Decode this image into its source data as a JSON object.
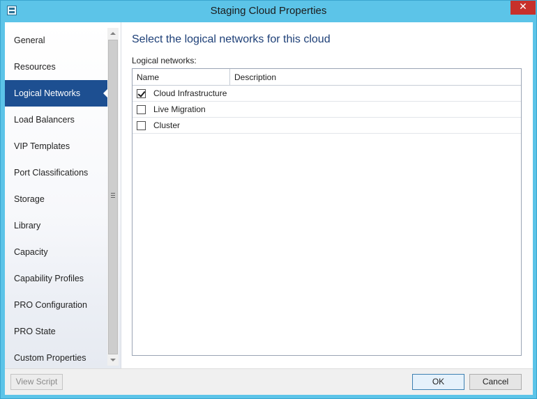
{
  "window": {
    "title": "Staging Cloud Properties",
    "close_glyph": "✕"
  },
  "nav": {
    "items": [
      {
        "label": "General"
      },
      {
        "label": "Resources"
      },
      {
        "label": "Logical Networks",
        "selected": true
      },
      {
        "label": "Load Balancers"
      },
      {
        "label": "VIP Templates"
      },
      {
        "label": "Port Classifications"
      },
      {
        "label": "Storage"
      },
      {
        "label": "Library"
      },
      {
        "label": "Capacity"
      },
      {
        "label": "Capability Profiles"
      },
      {
        "label": "PRO Configuration"
      },
      {
        "label": "PRO State"
      },
      {
        "label": "Custom Properties"
      }
    ]
  },
  "main": {
    "heading": "Select the logical networks for this cloud",
    "grid_label": "Logical networks:",
    "columns": [
      "Name",
      "Description"
    ],
    "rows": [
      {
        "name": "Cloud Infrastructure",
        "description": "",
        "checked": true
      },
      {
        "name": "Live Migration",
        "description": "",
        "checked": false
      },
      {
        "name": "Cluster",
        "description": "",
        "checked": false
      }
    ]
  },
  "footer": {
    "view_script": "View Script",
    "ok": "OK",
    "cancel": "Cancel"
  },
  "colors": {
    "titlebar": "#5cc4e8",
    "selected_nav": "#1d4f91",
    "heading": "#1d3f77",
    "close_button": "#c7302b"
  }
}
